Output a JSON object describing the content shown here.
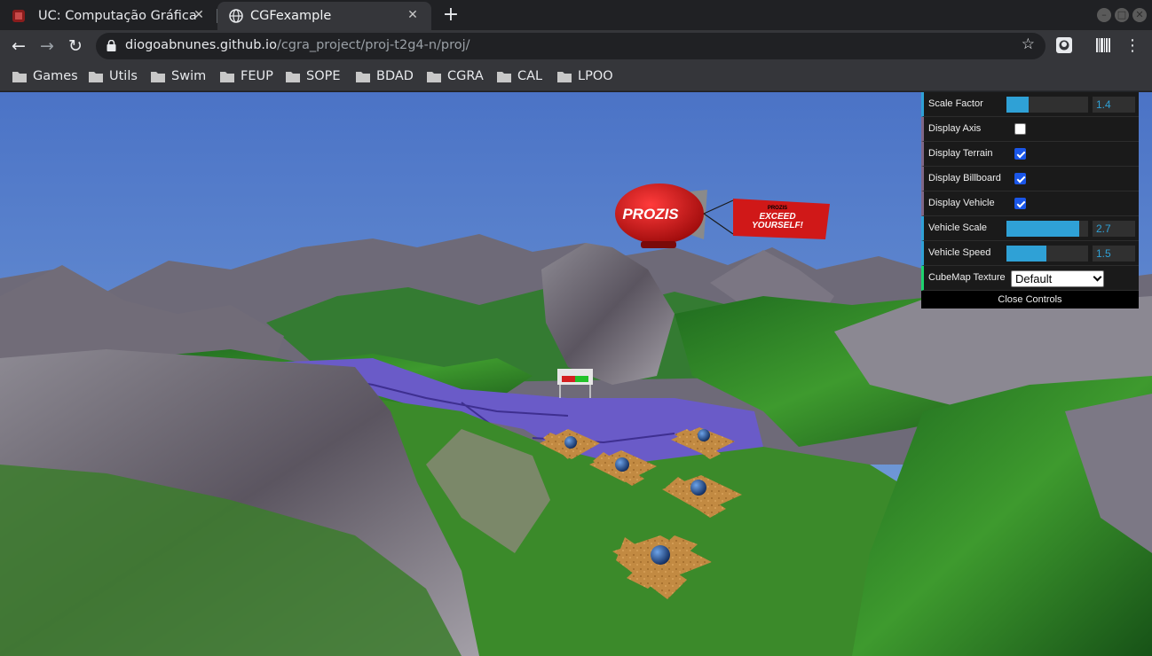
{
  "browser": {
    "tabs": [
      {
        "title": "UC: Computação Gráfica",
        "active": false
      },
      {
        "title": "CGFexample",
        "active": true
      }
    ],
    "url_host": "diogoabnunes.github.io",
    "url_path": "/cgra_project/proj-t2g4-n/proj/",
    "bookmarks": [
      "Games",
      "Utils",
      "Swim",
      "FEUP",
      "SOPE",
      "BDAD",
      "CGRA",
      "CAL",
      "LPOO"
    ]
  },
  "scene": {
    "blimp_logo": "PROZIS",
    "banner_line1": "EXCEED",
    "banner_line2": "YOURSELF!",
    "banner_small": "PROZIS",
    "sky_color": "#4f78c9",
    "blimp_color": "#d41414"
  },
  "gui": {
    "scale_factor": {
      "label": "Scale Factor",
      "value": "1.4",
      "fraction": 0.27
    },
    "display_axis": {
      "label": "Display Axis",
      "checked": false
    },
    "display_terrain": {
      "label": "Display Terrain",
      "checked": true
    },
    "display_billboard": {
      "label": "Display Billboard",
      "checked": true
    },
    "display_vehicle": {
      "label": "Display Vehicle",
      "checked": true
    },
    "vehicle_scale": {
      "label": "Vehicle Scale",
      "value": "2.7",
      "fraction": 0.89
    },
    "vehicle_speed": {
      "label": "Vehicle Speed",
      "value": "1.5",
      "fraction": 0.49
    },
    "cubemap_texture": {
      "label": "CubeMap Texture",
      "value": "Default"
    },
    "close_label": "Close Controls"
  }
}
